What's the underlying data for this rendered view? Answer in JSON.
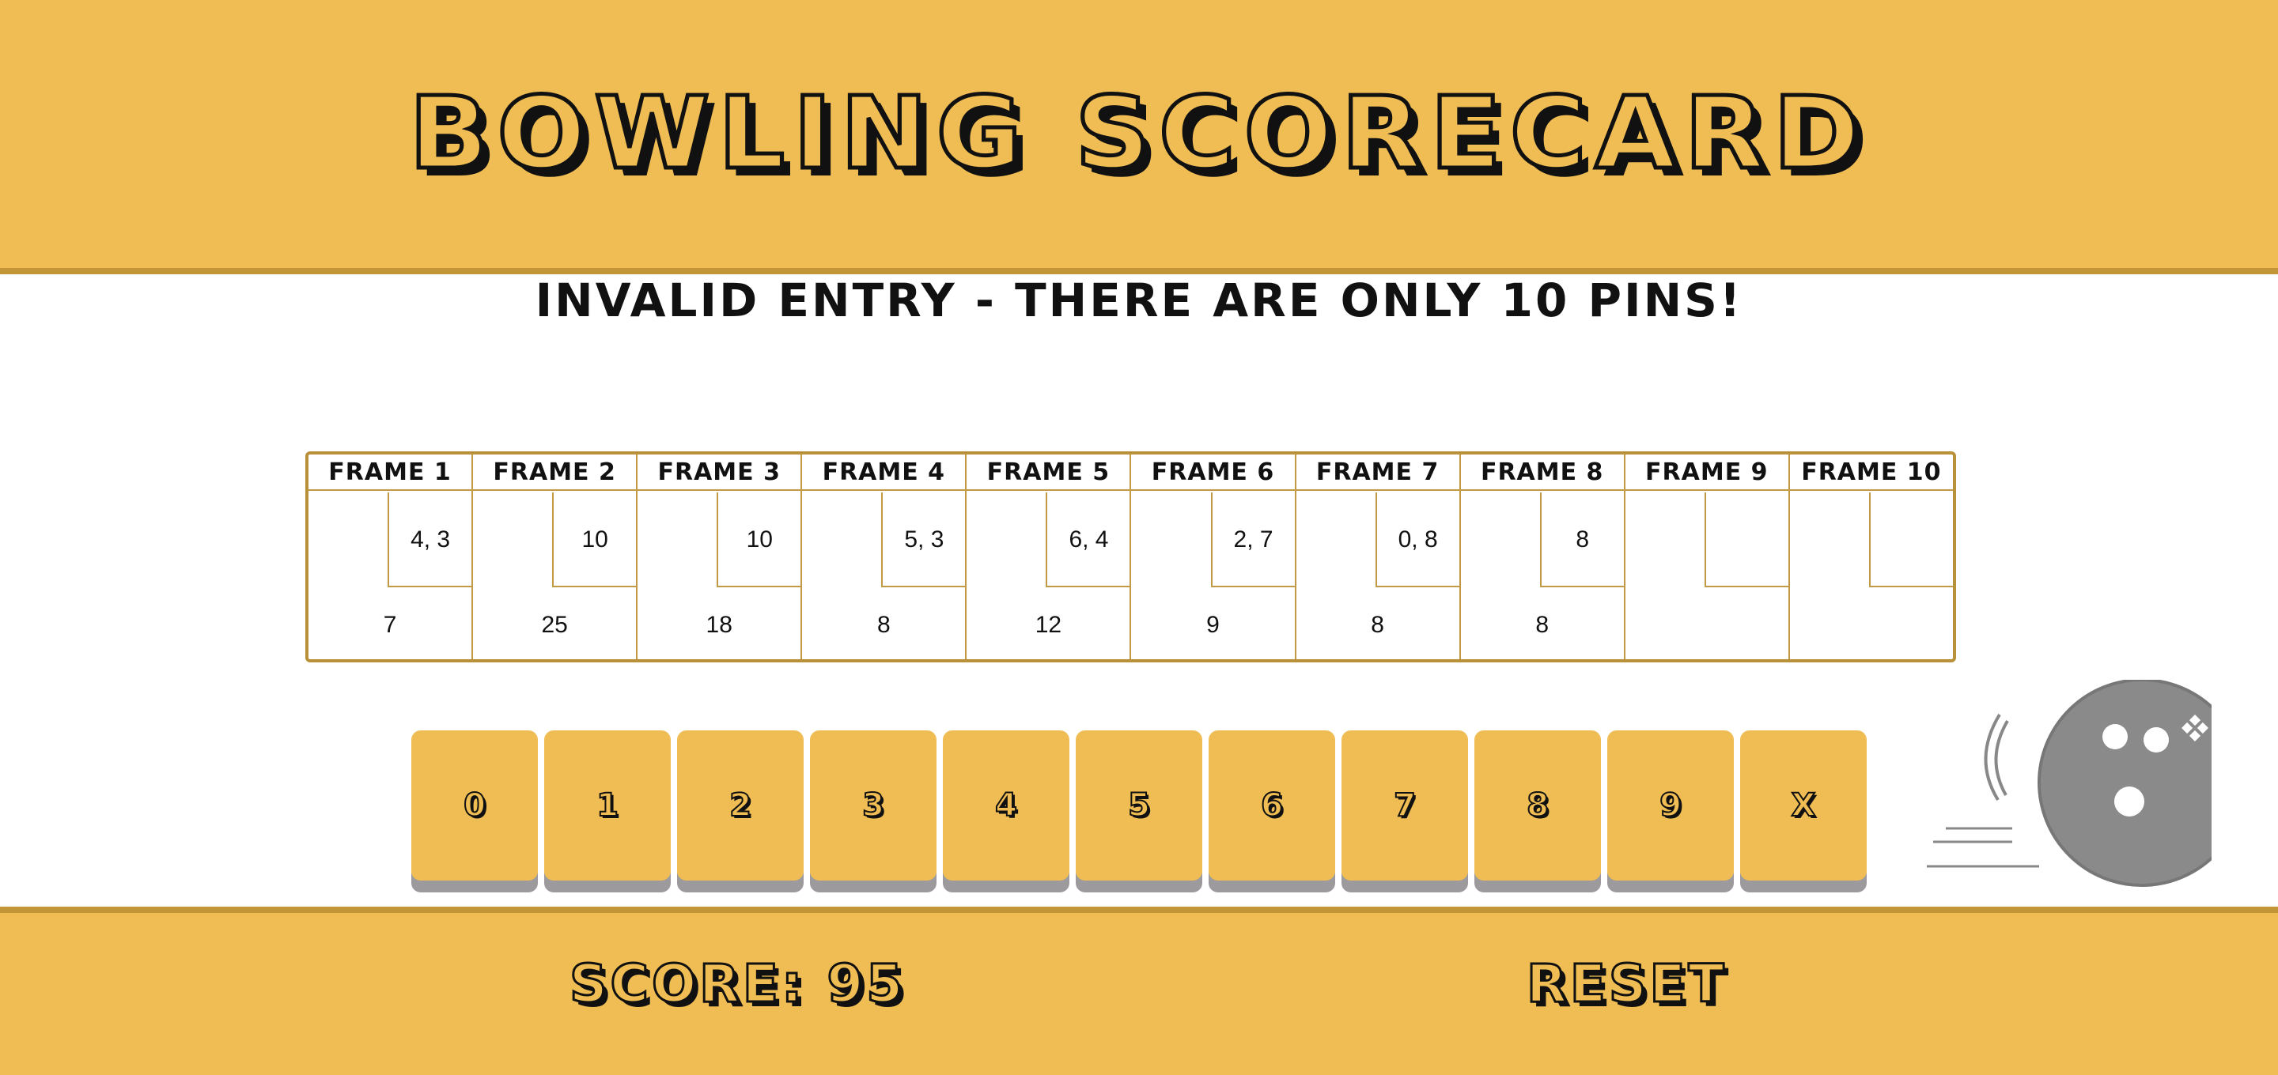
{
  "header": {
    "title": "BOWLING SCORECARD"
  },
  "message": "INVALID ENTRY - THERE ARE ONLY 10 PINS!",
  "frames": [
    {
      "label": "FRAME 1",
      "rolls": "4, 3",
      "total": "7"
    },
    {
      "label": "FRAME 2",
      "rolls": "10",
      "total": "25"
    },
    {
      "label": "FRAME 3",
      "rolls": "10",
      "total": "18"
    },
    {
      "label": "FRAME 4",
      "rolls": "5, 3",
      "total": "8"
    },
    {
      "label": "FRAME 5",
      "rolls": "6, 4",
      "total": "12"
    },
    {
      "label": "FRAME 6",
      "rolls": "2, 7",
      "total": "9"
    },
    {
      "label": "FRAME 7",
      "rolls": "0, 8",
      "total": "8"
    },
    {
      "label": "FRAME 8",
      "rolls": "8",
      "total": "8"
    },
    {
      "label": "FRAME 9",
      "rolls": "",
      "total": ""
    },
    {
      "label": "FRAME 10",
      "rolls": "",
      "total": ""
    }
  ],
  "keypad": [
    "0",
    "1",
    "2",
    "3",
    "4",
    "5",
    "6",
    "7",
    "8",
    "9",
    "X"
  ],
  "footer": {
    "score_label": "SCORE: 95",
    "reset_label": "RESET"
  },
  "colors": {
    "accent": "#efbd53",
    "border": "#c29536",
    "text": "#111111",
    "ball": "#8a8a8a"
  },
  "icons": {
    "ball": "bowling-ball-icon"
  }
}
